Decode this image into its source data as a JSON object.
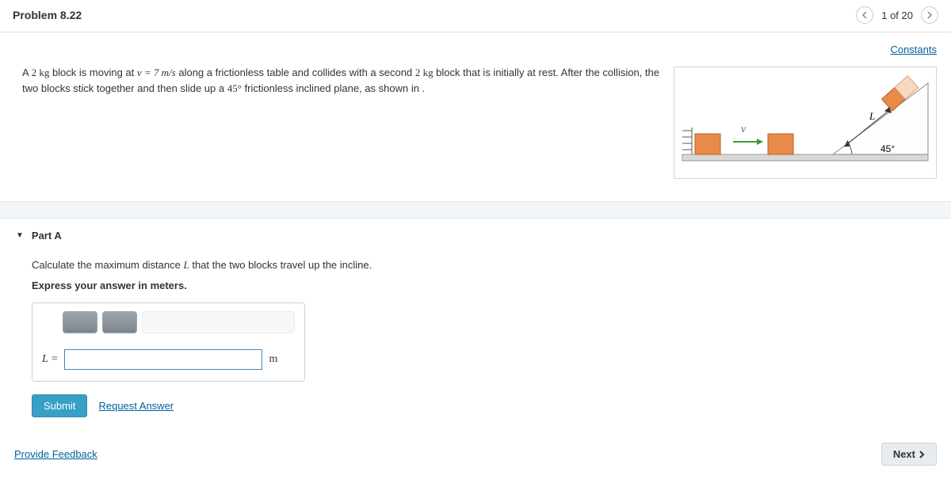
{
  "header": {
    "title": "Problem 8.22",
    "page_indicator": "1 of 20"
  },
  "links": {
    "constants": "Constants",
    "request_answer": "Request Answer",
    "provide_feedback": "Provide Feedback"
  },
  "problem": {
    "text_pre": "A ",
    "mass1": "2 kg",
    "text_mid1": " block is moving at ",
    "vel_eq": "v = 7 m/s",
    "text_mid2": " along a frictionless table and collides with a second ",
    "mass2": "2 kg",
    "text_mid3": " block that is initially at rest. After the collision, the two blocks stick together and then slide up a ",
    "angle": "45°",
    "text_end": " frictionless inclined plane, as shown in ."
  },
  "figure": {
    "v_label": "v",
    "L_label": "L",
    "angle_label": "45°"
  },
  "partA": {
    "title": "Part A",
    "prompt_pre": "Calculate the maximum distance ",
    "prompt_L": "L",
    "prompt_post": " that the two blocks travel up the incline.",
    "instruction": "Express your answer in meters.",
    "lhs": "L =",
    "unit": "m",
    "input_value": ""
  },
  "buttons": {
    "submit": "Submit",
    "next": "Next"
  }
}
